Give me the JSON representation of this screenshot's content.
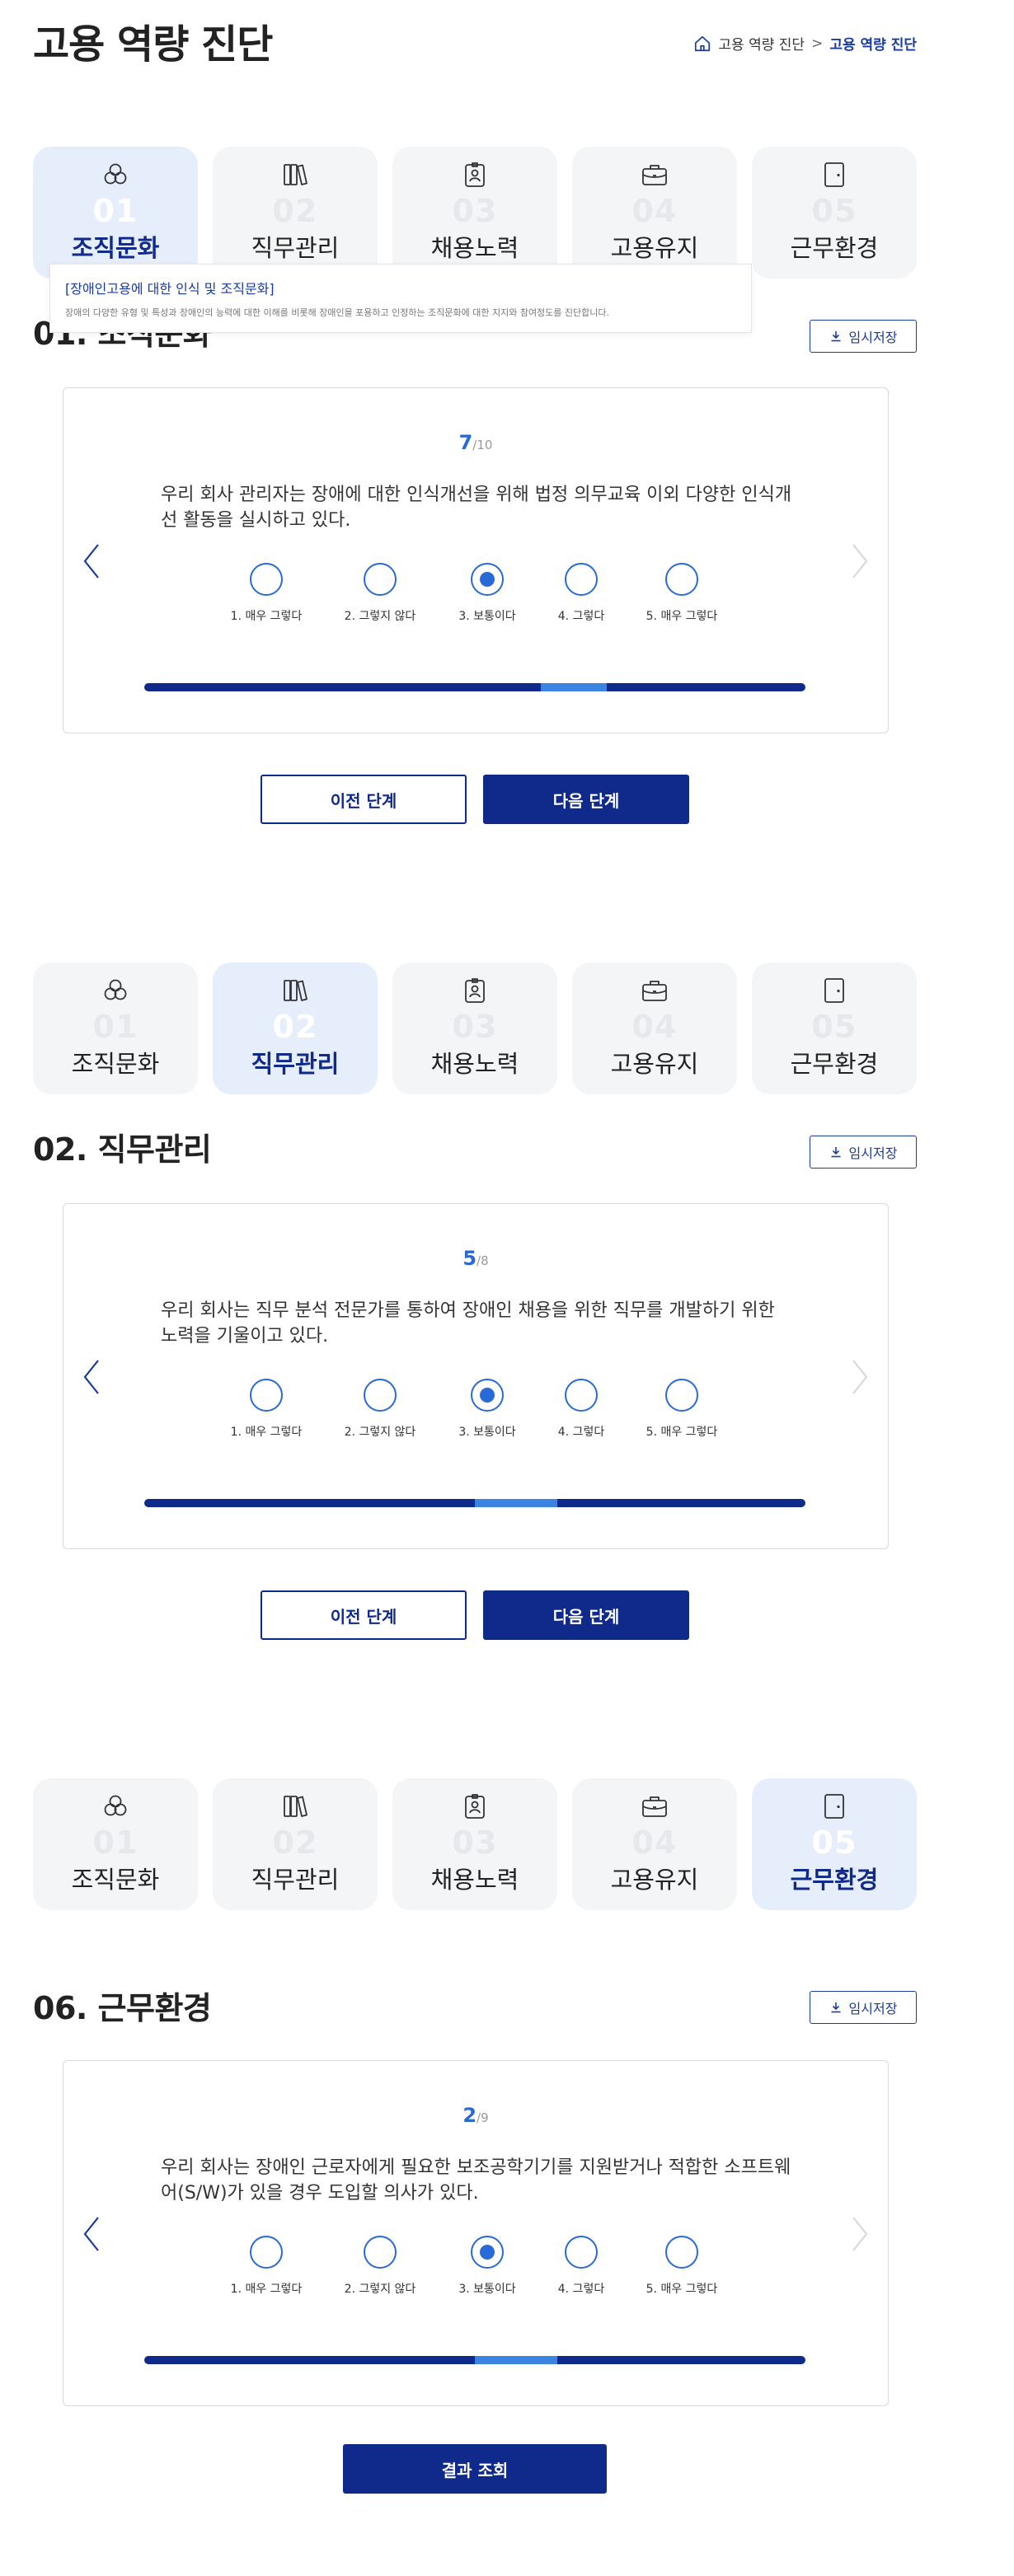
{
  "header": {
    "title": "고용 역량 진단",
    "breadcrumb": {
      "home_icon": "home-icon",
      "parent": "고용 역량 진단",
      "separator": ">",
      "current": "고용 역량 진단"
    }
  },
  "tabs": [
    {
      "num": "01",
      "label": "조직문화",
      "icon": "circles-icon"
    },
    {
      "num": "02",
      "label": "직무관리",
      "icon": "books-icon"
    },
    {
      "num": "03",
      "label": "채용노력",
      "icon": "id-badge-icon"
    },
    {
      "num": "04",
      "label": "고용유지",
      "icon": "briefcase-icon"
    },
    {
      "num": "05",
      "label": "근무환경",
      "icon": "door-icon"
    }
  ],
  "tooltip": {
    "title": "[장애인고용에 대한 인식 및 조직문화]",
    "desc": "장애의 다양한 유형 및 특성과 장애인의 능력에 대한 이해를 비롯해 장애인을 포용하고 인정하는 조직문화에 대한 지지와 참여정도를 진단합니다."
  },
  "options": [
    "1. 매우 그렇다",
    "2. 그렇지 않다",
    "3. 보통이다",
    "4. 그렇다",
    "5. 매우 그렇다"
  ],
  "save_label": "임시저장",
  "prev_step_label": "이전 단계",
  "next_step_label": "다음 단계",
  "result_label": "결과 조회",
  "colors": {
    "primary": "#102a8b",
    "accent": "#2a6ad6",
    "progress_highlight": "#3c84e2"
  },
  "sections": [
    {
      "active_tab": 0,
      "title": "01. 조직문화",
      "current": "7",
      "total": "/10",
      "question": "우리 회사 관리자는 장애에 대한 인식개선을 위해 법정 의무교육 이외 다양한 인식개선 활동을 실시하고 있다.",
      "selected": 2,
      "progress": {
        "current": 7,
        "total": 10
      }
    },
    {
      "active_tab": 1,
      "title": "02. 직무관리",
      "current": "5",
      "total": "/8",
      "question": "우리 회사는 직무 분석 전문가를 통하여 장애인 채용을 위한 직무를 개발하기 위한 노력을 기울이고 있다.",
      "selected": 2,
      "progress": {
        "current": 5,
        "total": 8
      }
    },
    {
      "active_tab": 4,
      "title": "06. 근무환경",
      "current": "2",
      "total": "/9",
      "question": "우리 회사는 장애인 근로자에게 필요한 보조공학기기를 지원받거나 적합한 소프트웨어(S/W)가 있을 경우 도입할 의사가 있다.",
      "selected": 2,
      "progress": {
        "current": 5,
        "total": 8
      }
    }
  ]
}
